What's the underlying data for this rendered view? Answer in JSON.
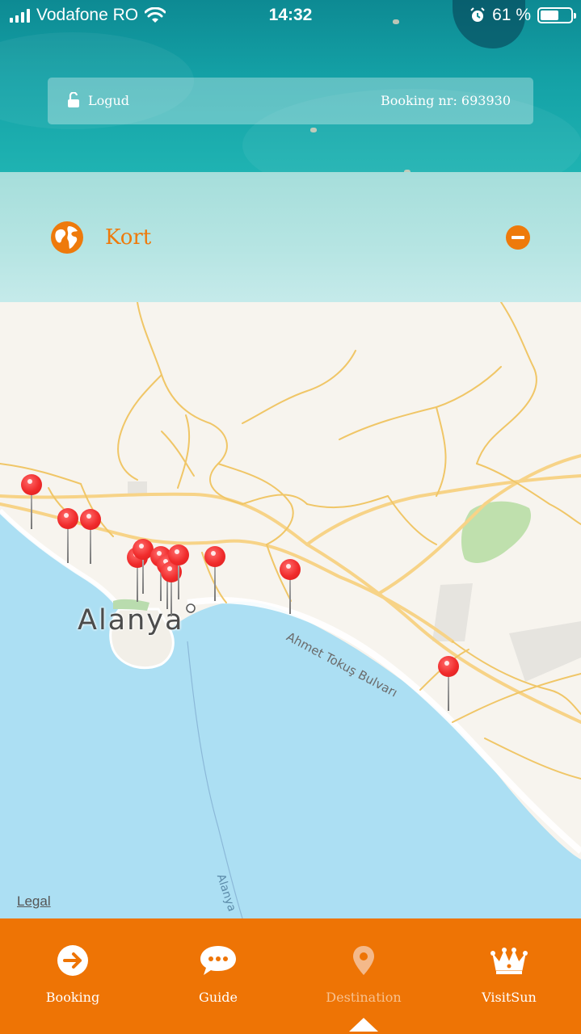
{
  "status_bar": {
    "carrier": "Vodafone RO",
    "time": "14:32",
    "battery_percent": "61 %",
    "battery_level": 0.61
  },
  "header": {
    "logout_label": "Logud",
    "booking_text": "Booking nr: 693930"
  },
  "section": {
    "title": "Kort",
    "icon": "globe-icon",
    "action_icon": "minus-circle-icon",
    "accent_color": "#ee7a0b"
  },
  "map": {
    "city_label": "Alanya",
    "street_label": "Ahmet Tokuş Bulvarı",
    "ferry_label": "Alanya",
    "legal_label": "Legal",
    "pin_count": 13,
    "pin_color": "#f02b2b",
    "sea_color": "#acdff3",
    "land_color": "#f7f4ee"
  },
  "tabs": [
    {
      "label": "Booking",
      "icon": "arrow-right-circle-icon",
      "active": false
    },
    {
      "label": "Guide",
      "icon": "speech-bubble-icon",
      "active": false
    },
    {
      "label": "Destination",
      "icon": "location-pin-icon",
      "active": true
    },
    {
      "label": "VisitSun",
      "icon": "crown-icon",
      "active": false
    }
  ],
  "tabbar_color": "#ee7405"
}
